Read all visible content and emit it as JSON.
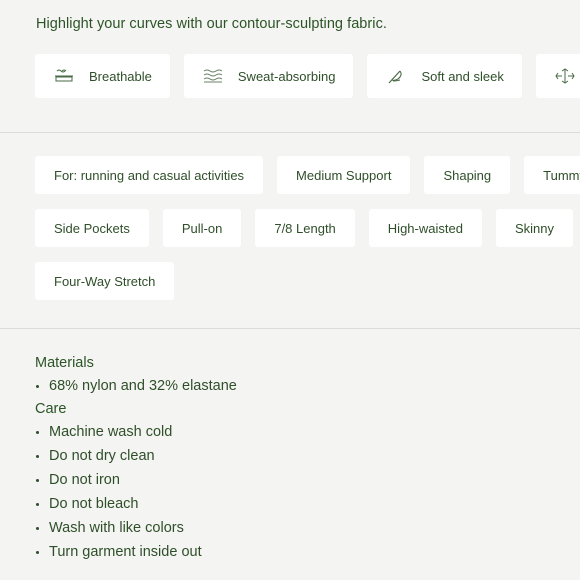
{
  "intro": {
    "text": "Highlight your curves with our contour-sculpting fabric."
  },
  "features": [
    {
      "label": "Breathable",
      "icon": "breathable-icon"
    },
    {
      "label": "Sweat-absorbing",
      "icon": "sweat-absorbing-icon"
    },
    {
      "label": "Soft and sleek",
      "icon": "feather-icon"
    },
    {
      "label": "",
      "icon": "stretch-icon"
    }
  ],
  "tags": {
    "row1": [
      "For: running and casual activities",
      "Medium Support",
      "Shaping",
      "Tummy"
    ],
    "row2": [
      "Side Pockets",
      "Pull-on",
      "7/8 Length",
      "High-waisted",
      "Skinny"
    ],
    "row3": [
      "Four-Way Stretch"
    ]
  },
  "materials": {
    "heading": "Materials",
    "items": [
      "68% nylon and 32% elastane"
    ]
  },
  "care": {
    "heading": "Care",
    "items": [
      "Machine wash cold",
      "Do not dry clean",
      "Do not iron",
      "Do not bleach",
      "Wash with like colors",
      "Turn garment inside out"
    ]
  },
  "colors": {
    "text": "#2f4f2a",
    "background": "#f4f4f2",
    "card": "#ffffff",
    "divider": "#dcdcd8"
  }
}
